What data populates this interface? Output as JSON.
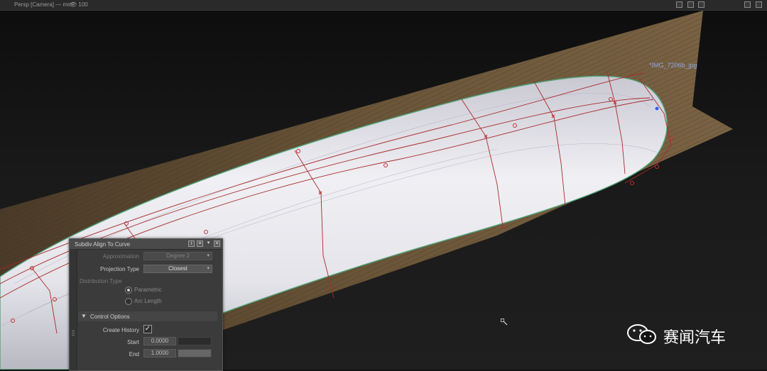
{
  "viewport": {
    "camera_label": "Persp [Camera]  — mm",
    "fov_label": "100",
    "reference_image_label": "*IMG_7206b_jpg"
  },
  "panel": {
    "title": "Subdiv Align To Curve",
    "approximation": {
      "label": "Approximation",
      "value": "Degree 2"
    },
    "projection_type": {
      "label": "Projection Type",
      "value": "Closest"
    },
    "distribution_type": {
      "label": "Distribution Type",
      "options": [
        "Parametric",
        "Arc Length"
      ],
      "selected": "Parametric"
    },
    "control_options": {
      "header": "Control Options",
      "create_history": {
        "label": "Create History",
        "checked": true
      },
      "start": {
        "label": "Start",
        "value": "0.0000",
        "fraction": 0
      },
      "end": {
        "label": "End",
        "value": "1.0000",
        "fraction": 1
      }
    }
  },
  "watermark": {
    "text": "赛闻汽车"
  },
  "colors": {
    "background": "#141414",
    "wood": "#5a4630",
    "surface": "#e6e6ea",
    "curve_red": "#a82a2a",
    "edge_green": "#4fa37a",
    "label_blue": "#8fa6e8",
    "panel_bg": "#3b3b3b"
  }
}
